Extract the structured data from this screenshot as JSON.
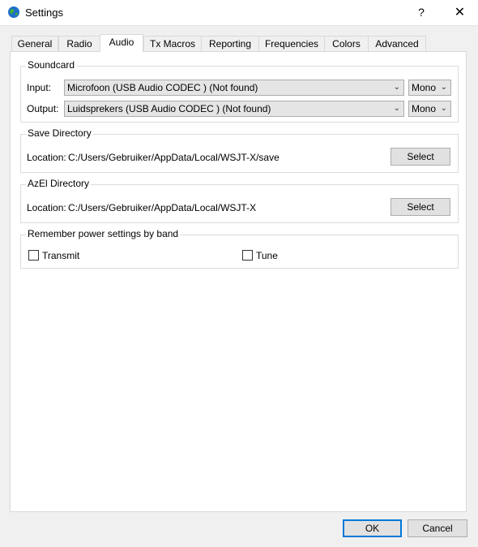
{
  "window": {
    "title": "Settings",
    "help_glyph": "?",
    "close_glyph": "✕",
    "icon": "globe-icon"
  },
  "tabs": [
    {
      "label": "General",
      "active": false
    },
    {
      "label": "Radio",
      "active": false
    },
    {
      "label": "Audio",
      "active": true
    },
    {
      "label": "Tx Macros",
      "active": false
    },
    {
      "label": "Reporting",
      "active": false
    },
    {
      "label": "Frequencies",
      "active": false
    },
    {
      "label": "Colors",
      "active": false
    },
    {
      "label": "Advanced",
      "active": false
    }
  ],
  "soundcard": {
    "title": "Soundcard",
    "input_label": "Input:",
    "input_value": "Microfoon (USB Audio CODEC ) (Not found)",
    "input_channel": "Mono",
    "output_label": "Output:",
    "output_value": "Luidsprekers (USB Audio CODEC ) (Not found)",
    "output_channel": "Mono"
  },
  "save_directory": {
    "title": "Save Directory",
    "location_label": "Location:",
    "path": "C:/Users/Gebruiker/AppData/Local/WSJT-X/save",
    "select_label": "Select"
  },
  "azel_directory": {
    "title": "AzEl Directory",
    "location_label": "Location:",
    "path": "C:/Users/Gebruiker/AppData/Local/WSJT-X",
    "select_label": "Select"
  },
  "power": {
    "title": "Remember power settings by band",
    "transmit_label": "Transmit",
    "transmit_checked": false,
    "tune_label": "Tune",
    "tune_checked": false
  },
  "footer": {
    "ok_label": "OK",
    "cancel_label": "Cancel"
  },
  "colors": {
    "default_button_border": "#0078d7",
    "panel_bg": "#ffffff",
    "window_bg": "#f0f0f0"
  }
}
